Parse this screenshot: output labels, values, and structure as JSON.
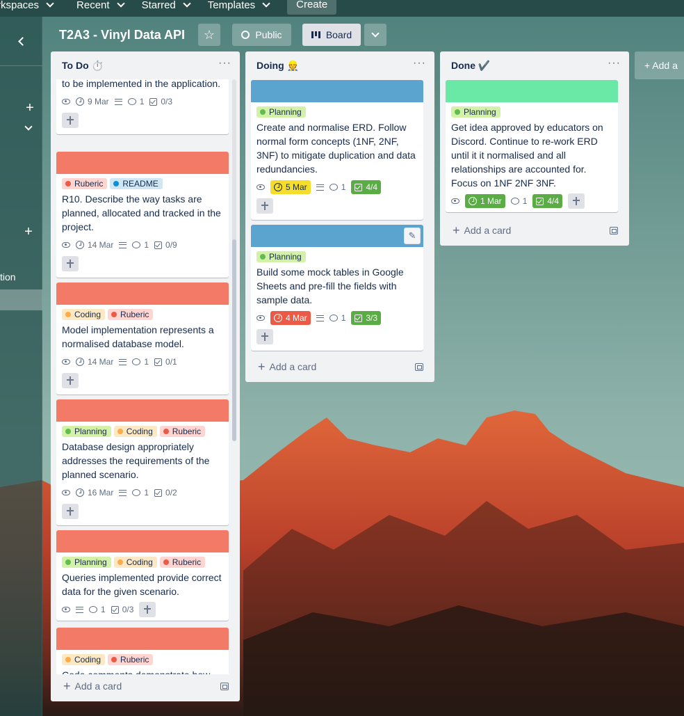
{
  "nav": {
    "workspaces": "rkspaces",
    "recent": "Recent",
    "starred": "Starred",
    "templates": "Templates",
    "create": "Create"
  },
  "sidebar": {
    "item_text": "tion"
  },
  "header": {
    "title": "T2A3 - Vinyl Data API",
    "visibility": "Public",
    "view": "Board"
  },
  "add_list": "+ Add a",
  "colors": {
    "cover_red": "#f27a67",
    "cover_blue": "#5ba4cf",
    "cover_green": "#6ae9a6",
    "label_planning_bg": "#d3f1a7",
    "label_planning_dot": "#61bd4f",
    "label_coding_bg": "#fce9c3",
    "label_coding_dot": "#ffab4a",
    "label_rubric_bg": "#ffd5d2",
    "label_rubric_dot": "#eb5a46",
    "label_readme_bg": "#cfe6f5",
    "label_readme_dot": "#0c8fd6",
    "due_yellow": "#f5dd29",
    "due_red": "#eb5a46",
    "complete_green": "#5aac44"
  },
  "lists": {
    "todo": {
      "title": "To Do ⏱️",
      "add_card": "Add a card",
      "cards": [
        {
          "title": "to be implemented in the application.",
          "date": "9 Mar",
          "comments": "1",
          "checklist": "0/3"
        },
        {
          "labels": [
            "Ruberic",
            "README"
          ],
          "title": "R10. Describe the way tasks are planned, allocated and tracked in the project.",
          "date": "14 Mar",
          "comments": "1",
          "checklist": "0/9"
        },
        {
          "labels": [
            "Coding",
            "Ruberic"
          ],
          "title": "Model implementation represents a normalised database model.",
          "date": "14 Mar",
          "comments": "1",
          "checklist": "0/1"
        },
        {
          "labels": [
            "Planning",
            "Coding",
            "Ruberic"
          ],
          "title": "Database design appropriately addresses the requirements of the planned scenario.",
          "date": "16 Mar",
          "comments": "1",
          "checklist": "0/2"
        },
        {
          "labels": [
            "Planning",
            "Coding",
            "Ruberic"
          ],
          "title": "Queries implemented provide correct data for the given scenario.",
          "comments": "1",
          "checklist": "0/3"
        },
        {
          "labels": [
            "Coding",
            "Ruberic"
          ],
          "title": "Code comments demonstrate how"
        }
      ]
    },
    "doing": {
      "title": "Doing 👷",
      "add_card": "Add a card",
      "cards": [
        {
          "labels": [
            "Planning"
          ],
          "title": "Create and normalise ERD. Follow normal form concepts (1NF, 2NF, 3NF) to mitigate duplication and data redundancies.",
          "date": "5 Mar",
          "comments": "1",
          "checklist": "4/4"
        },
        {
          "labels": [
            "Planning"
          ],
          "title": "Build some mock tables in Google Sheets and pre-fill the fields with sample data.",
          "date": "4 Mar",
          "comments": "1",
          "checklist": "3/3"
        }
      ]
    },
    "done": {
      "title": "Done ✔️",
      "add_card": "Add a card",
      "cards": [
        {
          "labels": [
            "Planning"
          ],
          "title": "Get idea approved by educators on Discord. Continue to re-work ERD until it it normalised and all relationships are accounted for. Focus on 1NF 2NF 3NF.",
          "date": "1 Mar",
          "comments": "1",
          "checklist": "4/4"
        }
      ]
    }
  }
}
